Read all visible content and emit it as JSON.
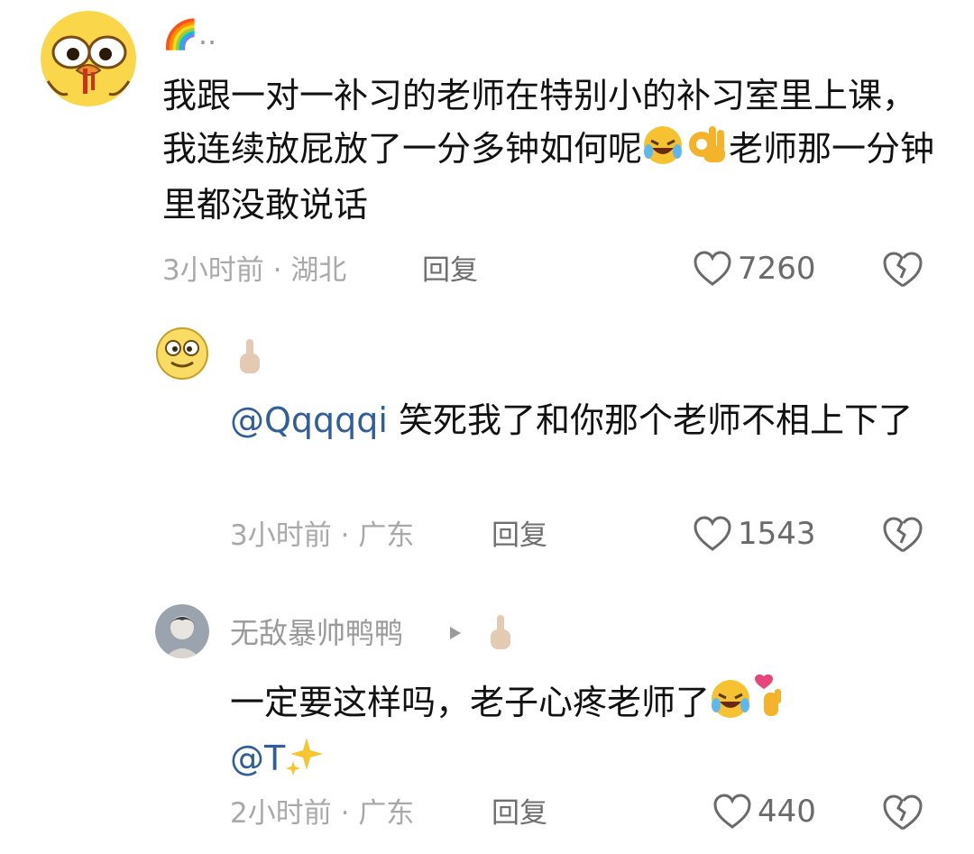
{
  "comments": [
    {
      "avatar": "duck-emoji-avatar",
      "username": "🌈..",
      "text_parts": [
        "我跟一对一补习的老师在特别小的补习室里上课，我连续放屁放了一分多钟如何呢",
        "老师那一分钟里都没敢说话"
      ],
      "emojis": [
        "rolling-laughing-emoji",
        "ok-hand-emoji"
      ],
      "time": "3小时前",
      "location": "湖北",
      "reply_label": "回复",
      "likes": "7260"
    },
    {
      "avatar": "smiley-face-avatar",
      "username_icon": "pointing-up-hand-emoji",
      "mention": "@Qqqqqi",
      "text": " 笑死我了和你那个老师不相上下了",
      "time": "3小时前",
      "location": "广东",
      "reply_label": "回复",
      "likes": "1543"
    },
    {
      "avatar": "anime-character-avatar",
      "username": "无敌暴帅鸭鸭",
      "username_icon": "pointing-up-hand-emoji",
      "text": "一定要这样吗，老子心疼老师了",
      "emojis": [
        "rolling-laughing-emoji",
        "finger-heart-emoji",
        "sparkles-emoji"
      ],
      "mention": "@T",
      "time": "2小时前",
      "location": "广东",
      "reply_label": "回复",
      "likes": "440"
    }
  ],
  "separator": "·",
  "colors": {
    "mention": "#2f5e9b",
    "meta": "#a9a9a9",
    "text": "#111111"
  }
}
